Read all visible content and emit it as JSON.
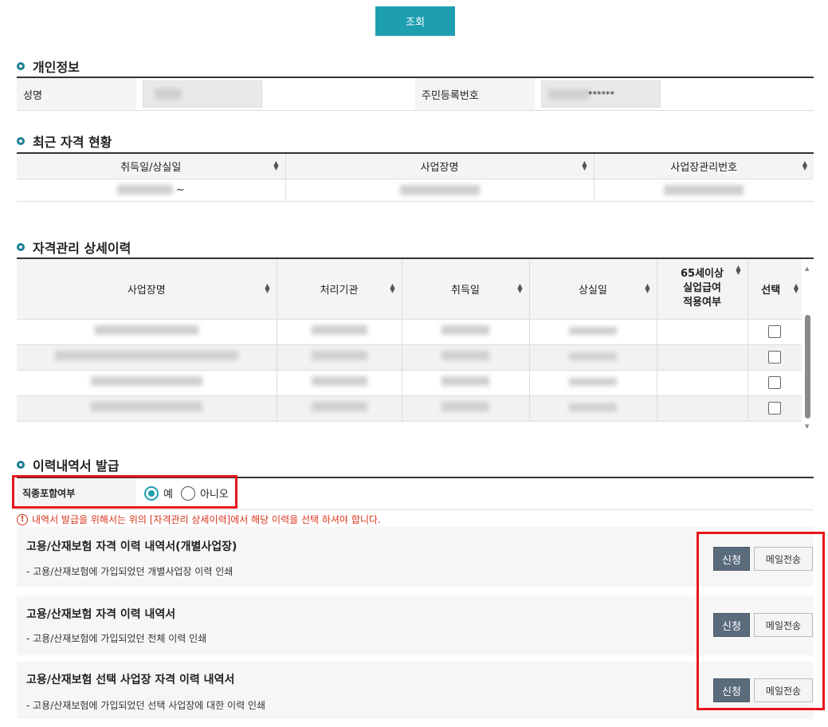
{
  "search_button": "조회",
  "personal_info": {
    "title": "개인정보",
    "name_label": "성명",
    "rrn_label": "주민등록번호",
    "rrn_suffix": "******"
  },
  "recent": {
    "title": "최근 자격 현황",
    "columns": [
      "취득일/상실일",
      "사업장명",
      "사업장관리번호"
    ],
    "date_suffix": "~"
  },
  "history": {
    "title": "자격관리 상세이력",
    "columns": [
      "사업장명",
      "처리기관",
      "취득일",
      "상실일",
      "65세이상\n실업급여\n적용여부",
      "선택"
    ],
    "row_count": 4
  },
  "issuance": {
    "title": "이력내역서 발급",
    "job_label": "직종포함여부",
    "yes": "예",
    "no": "아니오",
    "selected": "예",
    "notice": "내역서 발급을 위해서는 위의 [자격관리 상세이력]에서 해당 이력을 선택 하셔야 합니다.",
    "documents": [
      {
        "title": "고용/산재보험 자격 이력 내역서(개별사업장)",
        "desc": "- 고용/산재보험에 가입되었던 개별사업장 이력 인쇄",
        "apply": "신청",
        "mail": "메일전송"
      },
      {
        "title": "고용/산재보험 자격 이력 내역서",
        "desc": "- 고용/산재보험에 가입되었던 전체 이력 인쇄",
        "apply": "신청",
        "mail": "메일전송"
      },
      {
        "title": "고용/산재보험 선택 사업장 자격 이력 내역서",
        "desc": "- 고용/산재보험에 가입되었던 선택 사업장에 대한 이력 인쇄",
        "apply": "신청",
        "mail": "메일전송"
      }
    ]
  },
  "colors": {
    "accent": "#1e9fb0",
    "highlight": "#e8141b",
    "apply": "#5a6b7c",
    "notice": "#d9361c"
  }
}
